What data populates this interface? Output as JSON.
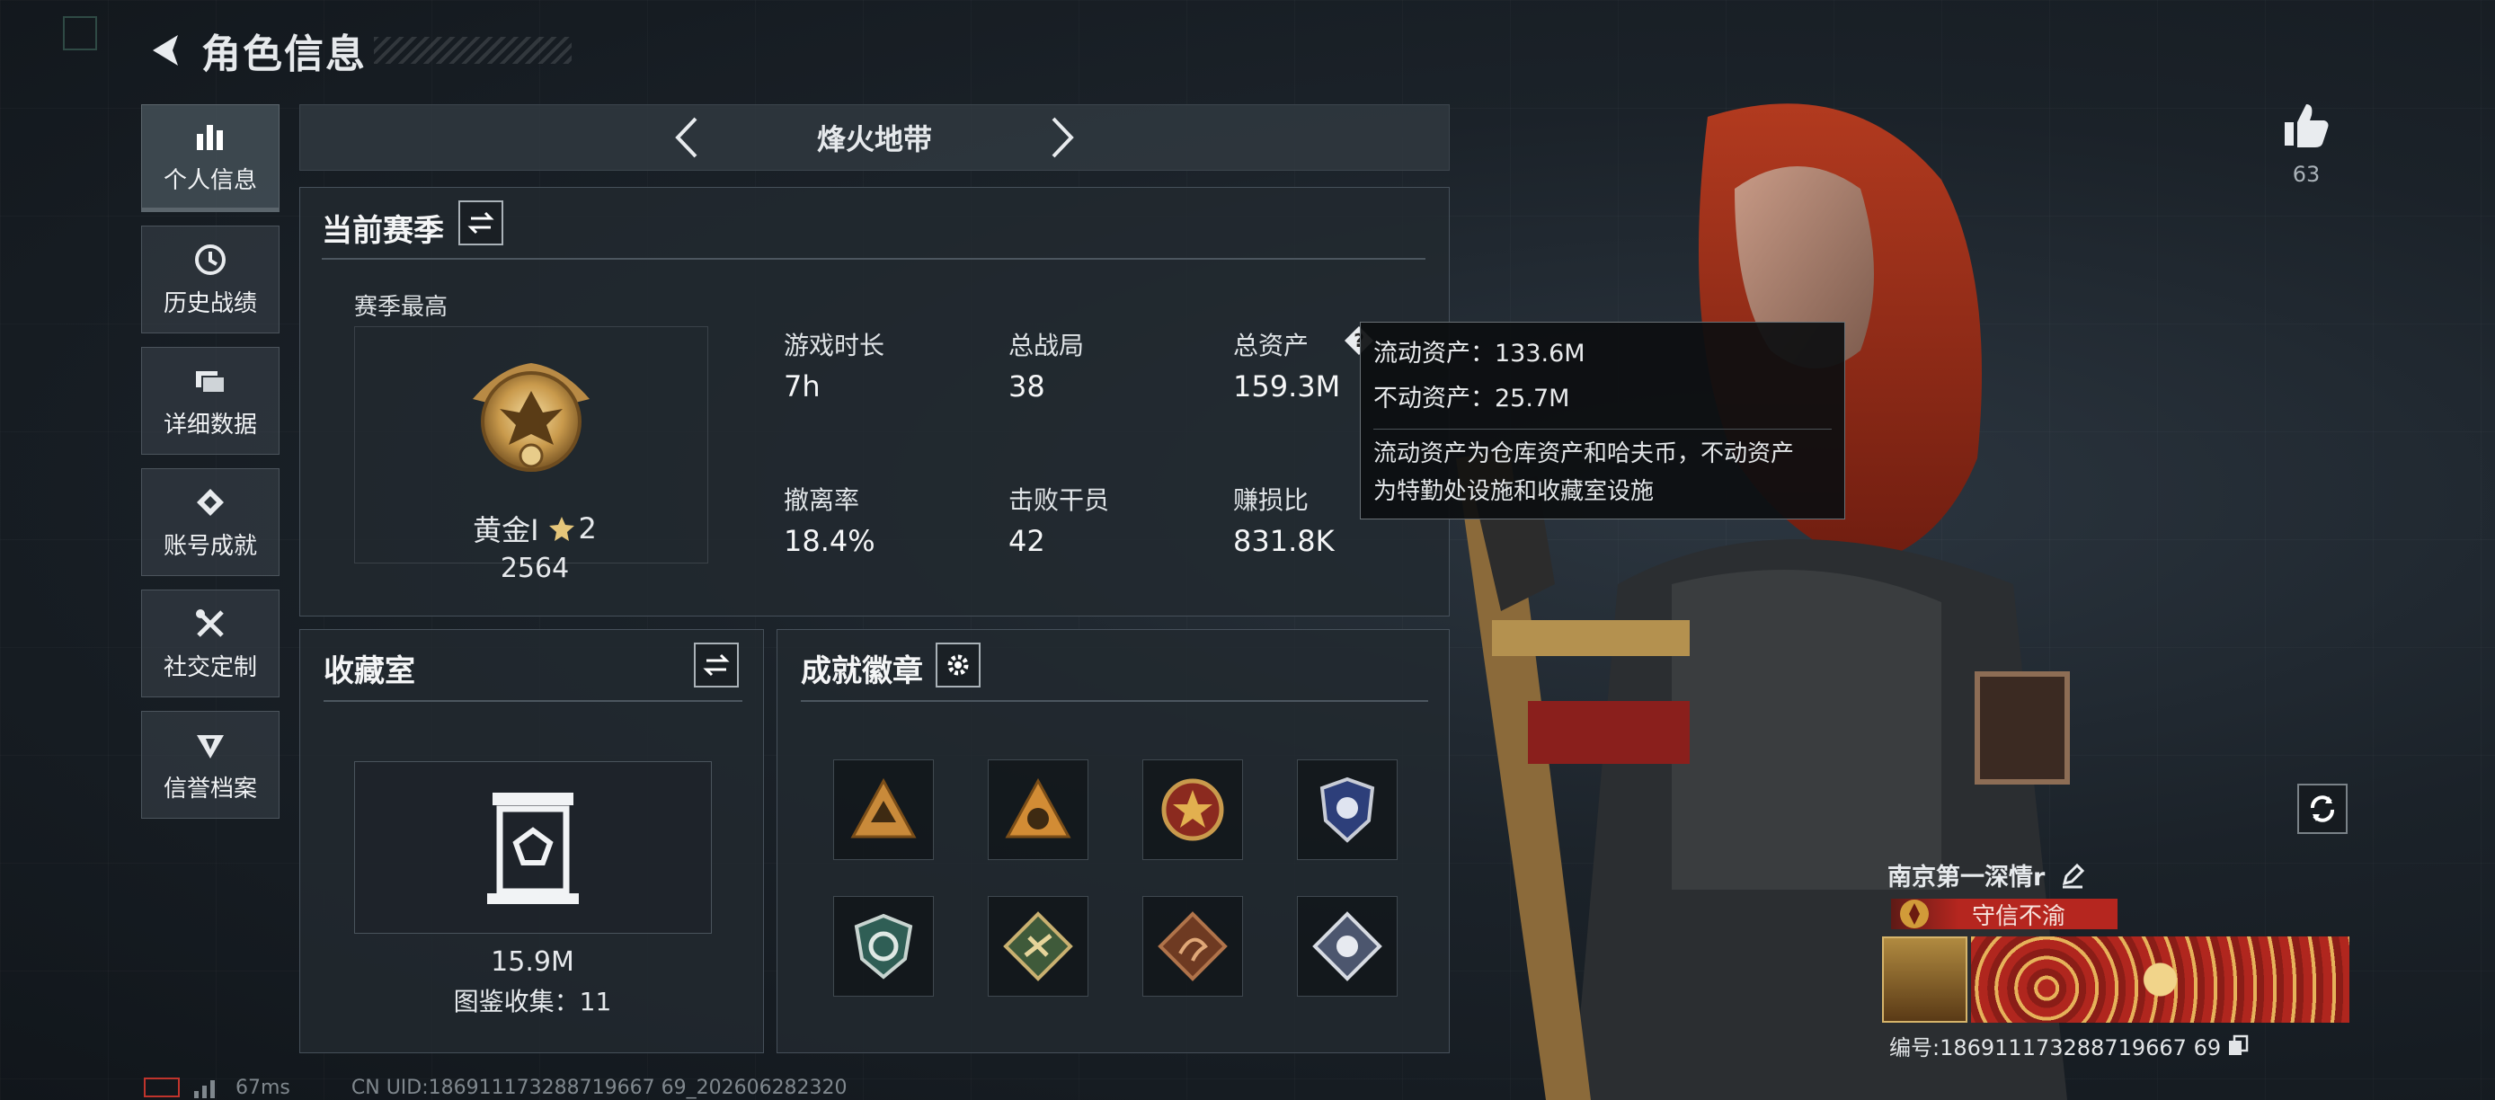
{
  "header": {
    "title": "角色信息"
  },
  "nav": {
    "items": [
      {
        "label": "个人信息",
        "icon": "bar-chart-icon",
        "active": true
      },
      {
        "label": "历史战绩",
        "icon": "history-icon"
      },
      {
        "label": "详细数据",
        "icon": "folder-icon"
      },
      {
        "label": "账号成就",
        "icon": "achievement-icon"
      },
      {
        "label": "社交定制",
        "icon": "tools-icon"
      },
      {
        "label": "信誉档案",
        "icon": "shield-icon"
      }
    ]
  },
  "mode": {
    "name": "烽火地带"
  },
  "season": {
    "title": "当前赛季",
    "best_label": "赛季最高",
    "rank_name": "黄金Ⅰ",
    "rank_stars": "2",
    "rank_score": "2564",
    "stats": [
      {
        "label": "游戏时长",
        "value": "7h"
      },
      {
        "label": "总战局",
        "value": "38"
      },
      {
        "label": "总资产",
        "value": "159.3M"
      },
      {
        "label": "撤离率",
        "value": "18.4%"
      },
      {
        "label": "击败干员",
        "value": "42"
      },
      {
        "label": "赚损比",
        "value": "831.8K"
      }
    ]
  },
  "tooltip": {
    "liquid": "流动资产：133.6M",
    "fixed": "不动资产：25.7M",
    "desc_line1": "流动资产为仓库资产和哈夫币，不动资产",
    "desc_line2": "为特勤处设施和收藏室设施"
  },
  "collection": {
    "title": "收藏室",
    "value": "15.9M",
    "catalog": "图鉴收集：11"
  },
  "achievements": {
    "title": "成就徽章",
    "badges": [
      "orange-triangle-badge-icon",
      "orange-triangle-badge-icon",
      "red-star-badge-icon",
      "blue-shield-badge-icon",
      "green-shield-badge-icon",
      "green-diamond-badge-icon",
      "dragon-diamond-badge-icon",
      "silver-diamond-badge-icon"
    ]
  },
  "player": {
    "likes": "63",
    "name": "南京第一深情r",
    "motto": "守信不渝",
    "id_text": "编号:186911173288719667 69"
  },
  "footer": {
    "ping": "67ms",
    "uid": "CN UID:186911173288719667 69_202606282320"
  }
}
